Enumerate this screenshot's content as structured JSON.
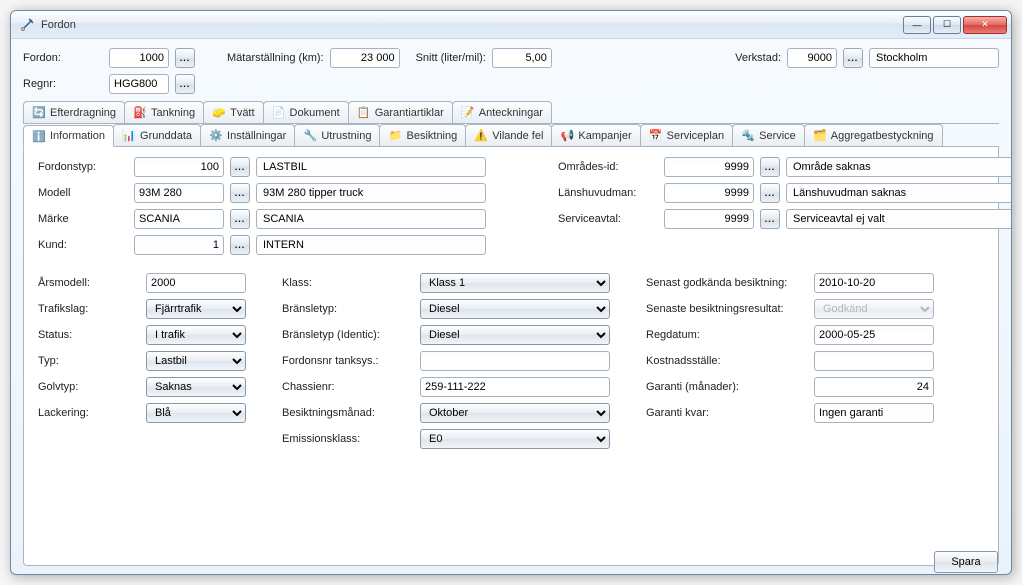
{
  "window": {
    "title": "Fordon"
  },
  "win_controls": {
    "minimize": "—",
    "maximize": "☐",
    "close": "✕"
  },
  "header": {
    "fordon_label": "Fordon:",
    "fordon_value": "1000",
    "matar_label": "Mätarställning (km):",
    "matar_value": "23 000",
    "snitt_label": "Snitt (liter/mil):",
    "snitt_value": "5,00",
    "verkstad_label": "Verkstad:",
    "verkstad_value": "9000",
    "verkstad_name": "Stockholm",
    "regnr_label": "Regnr:",
    "regnr_value": "HGG800"
  },
  "tabs_upper": [
    {
      "label": "Efterdragning"
    },
    {
      "label": "Tankning"
    },
    {
      "label": "Tvätt"
    },
    {
      "label": "Dokument"
    },
    {
      "label": "Garantiartiklar"
    },
    {
      "label": "Anteckningar"
    }
  ],
  "tabs_lower": [
    {
      "label": "Information",
      "active": true
    },
    {
      "label": "Grunddata"
    },
    {
      "label": "Inställningar"
    },
    {
      "label": "Utrustning"
    },
    {
      "label": "Besiktning"
    },
    {
      "label": "Vilande fel"
    },
    {
      "label": "Kampanjer"
    },
    {
      "label": "Serviceplan"
    },
    {
      "label": "Service"
    },
    {
      "label": "Aggregatbestyckning"
    }
  ],
  "info_top": {
    "fordonstyp_label": "Fordonstyp:",
    "fordonstyp_code": "100",
    "fordonstyp_text": "LASTBIL",
    "modell_label": "Modell",
    "modell_code": "93M 280",
    "modell_text": "93M 280 tipper truck",
    "marke_label": "Märke",
    "marke_code": "SCANIA",
    "marke_text": "SCANIA",
    "kund_label": "Kund:",
    "kund_code": "1",
    "kund_text": "INTERN",
    "omrades_label": "Områdes-id:",
    "omrades_code": "9999",
    "omrades_text": "Område saknas",
    "lanshuvud_label": "Länshuvudman:",
    "lanshuvud_code": "9999",
    "lanshuvud_text": "Länshuvudman saknas",
    "serviceavtal_label": "Serviceavtal:",
    "serviceavtal_code": "9999",
    "serviceavtal_text": "Serviceavtal ej valt"
  },
  "left_col": {
    "arsmodell_label": "Årsmodell:",
    "arsmodell_value": "2000",
    "trafikslag_label": "Trafikslag:",
    "trafikslag_value": "Fjärrtrafik",
    "status_label": "Status:",
    "status_value": "I trafik",
    "typ_label": "Typ:",
    "typ_value": "Lastbil",
    "golvtyp_label": "Golvtyp:",
    "golvtyp_value": "Saknas",
    "lackering_label": "Lackering:",
    "lackering_value": "Blå"
  },
  "mid_col": {
    "klass_label": "Klass:",
    "klass_value": "Klass 1",
    "bransletyp_label": "Bränsletyp:",
    "bransletyp_value": "Diesel",
    "bransletyp_identic_label": "Bränsletyp (Identic):",
    "bransletyp_identic_value": "Diesel",
    "fordonsnr_label": "Fordonsnr tanksys.:",
    "fordonsnr_value": "",
    "chassienr_label": "Chassienr:",
    "chassienr_value": "259-111-222",
    "besiktmanad_label": "Besiktningsmånad:",
    "besiktmanad_value": "Oktober",
    "emissionsklass_label": "Emissionsklass:",
    "emissionsklass_value": "E0"
  },
  "right_col": {
    "senast_godkand_label": "Senast godkända besiktning:",
    "senast_godkand_value": "2010-10-20",
    "senaste_resultat_label": "Senaste besiktningsresultat:",
    "senaste_resultat_value": "Godkänd",
    "regdatum_label": "Regdatum:",
    "regdatum_value": "2000-05-25",
    "kostnadsstalle_label": "Kostnadsställe:",
    "kostnadsstalle_value": "",
    "garanti_man_label": "Garanti (månader):",
    "garanti_man_value": "24",
    "garanti_kvar_label": "Garanti kvar:",
    "garanti_kvar_value": "Ingen garanti"
  },
  "buttons": {
    "dots": "...",
    "save": "Spara"
  }
}
